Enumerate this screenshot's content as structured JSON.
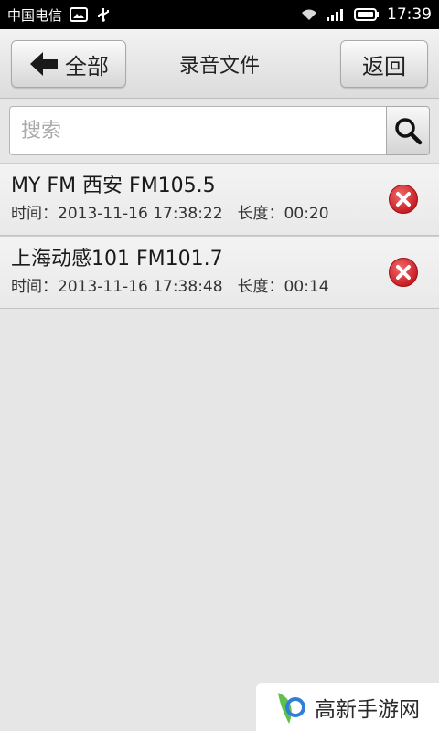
{
  "status_bar": {
    "carrier": "中国电信",
    "time": "17:39",
    "left_icons": [
      "image-notification-icon",
      "usb-icon"
    ],
    "right_icons": [
      "wifi-icon",
      "signal-icon",
      "battery-icon"
    ]
  },
  "header": {
    "all_label": "全部",
    "title": "录音文件",
    "back_label": "返回"
  },
  "search": {
    "placeholder": "搜索",
    "value": ""
  },
  "recordings": [
    {
      "title": "MY FM 西安 FM105.5",
      "time_label": "时间：2013-11-16 17:38:22",
      "duration_label": "长度：00:20"
    },
    {
      "title": "上海动感101 FM101.7",
      "time_label": "时间：2013-11-16 17:38:48",
      "duration_label": "长度：00:14"
    }
  ],
  "watermark": {
    "text": "高新手游网"
  },
  "colors": {
    "background": "#e6e6e6",
    "delete_red": "#d9262c",
    "watermark_green": "#5fc04a",
    "watermark_blue": "#2f7fd8"
  }
}
